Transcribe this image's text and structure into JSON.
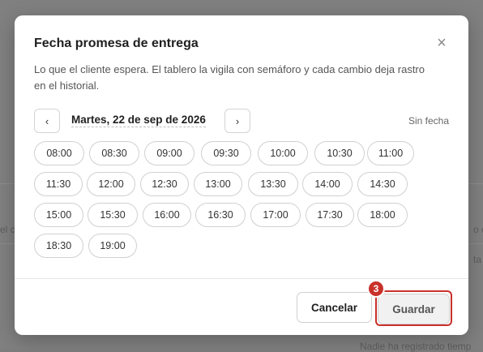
{
  "background": {
    "texts": [
      "el c",
      "o co",
      "ta d",
      "Nadie ha registrado tiemp"
    ]
  },
  "modal": {
    "title": "Fecha promesa de entrega",
    "close_icon": "close-icon",
    "description": "Lo que el cliente espera. El tablero la vigila con semáforo y cada cambio deja rastro en el historial.",
    "prev_label": "‹",
    "next_label": "›",
    "selected_date": "Martes, 22 de sep de 2026",
    "no_date_label": "Sin fecha",
    "time_slots": [
      "08:00",
      "08:30",
      "09:00",
      "09:30",
      "10:00",
      "10:30",
      "11:00",
      "11:30",
      "12:00",
      "12:30",
      "13:00",
      "13:30",
      "14:00",
      "14:30",
      "15:00",
      "15:30",
      "16:00",
      "16:30",
      "17:00",
      "17:30",
      "18:00",
      "18:30",
      "19:00"
    ],
    "cancel_label": "Cancelar",
    "save_label": "Guardar",
    "step_badge": "3"
  },
  "colors": {
    "accent_highlight": "#c9312b",
    "overlay": "#808080"
  }
}
